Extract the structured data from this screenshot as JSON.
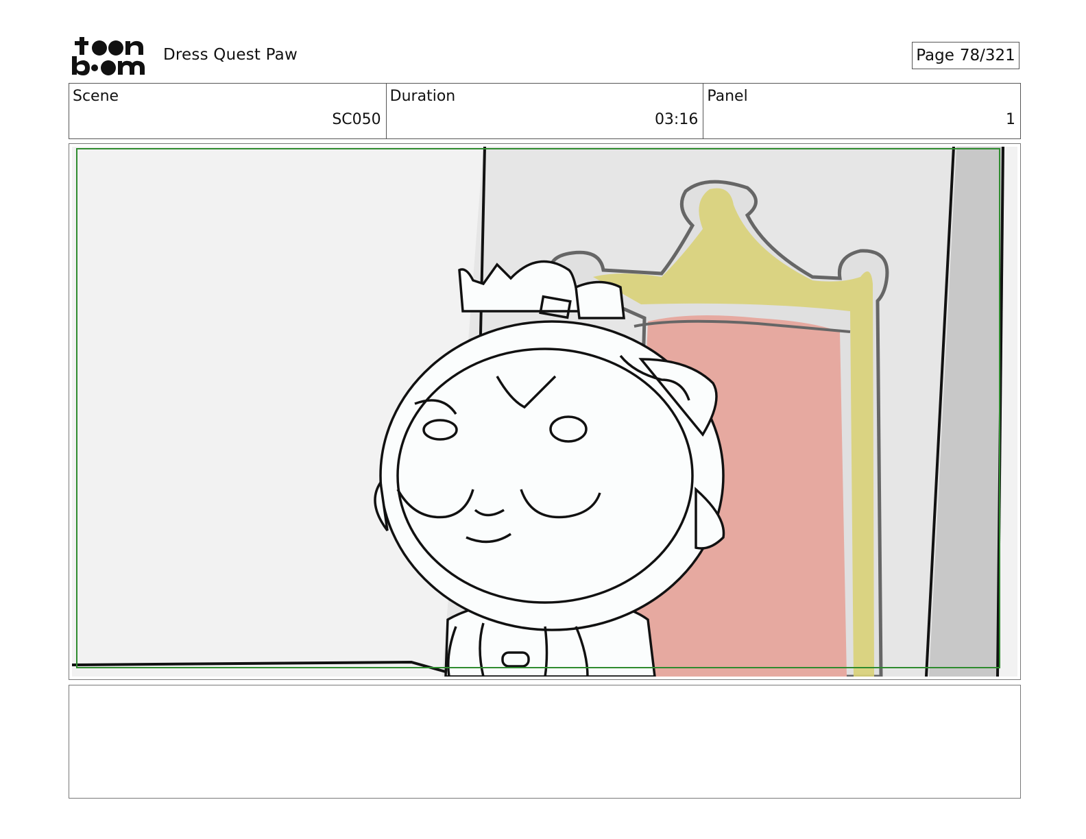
{
  "header": {
    "logo_text_top": "toon",
    "logo_text_bottom": "boom",
    "project_title": "Dress Quest Paw",
    "page_label": "Page",
    "page_number": "78/321"
  },
  "info": {
    "scene_label": "Scene",
    "scene_value": "SC050",
    "duration_label": "Duration",
    "duration_value": "03:16",
    "panel_label": "Panel",
    "panel_value": "1"
  },
  "panel": {
    "icon": "storyboard-drawing",
    "safe_frame_color": "#2e8b2e",
    "wall_color": "#f2f2f2",
    "throne_fill_color": "#e6a9a0",
    "throne_frame_color": "#d9d278"
  },
  "notes": {
    "text": ""
  }
}
